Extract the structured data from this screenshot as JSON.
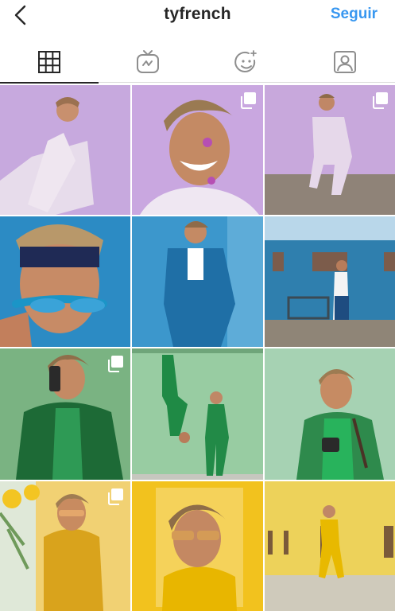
{
  "header": {
    "username": "tyfrench",
    "follow_label": "Seguir",
    "back_icon": "chevron-left-icon"
  },
  "tabs": [
    {
      "icon": "grid-icon",
      "active": true
    },
    {
      "icon": "igtv-icon",
      "active": false
    },
    {
      "icon": "face-filter-icon",
      "active": false
    },
    {
      "icon": "tagged-icon",
      "active": false
    }
  ],
  "colors": {
    "accent": "#3897f0",
    "text": "#262626",
    "divider": "#dbdbdb"
  },
  "posts": [
    {
      "theme": "lavender",
      "multiple": false
    },
    {
      "theme": "lavender",
      "multiple": true
    },
    {
      "theme": "lavender",
      "multiple": true
    },
    {
      "theme": "blue",
      "multiple": false
    },
    {
      "theme": "blue",
      "multiple": false
    },
    {
      "theme": "blue",
      "multiple": false
    },
    {
      "theme": "green",
      "multiple": true
    },
    {
      "theme": "green",
      "multiple": false
    },
    {
      "theme": "green",
      "multiple": false
    },
    {
      "theme": "yellow",
      "multiple": true
    },
    {
      "theme": "yellow",
      "multiple": false
    },
    {
      "theme": "yellow",
      "multiple": false
    }
  ]
}
